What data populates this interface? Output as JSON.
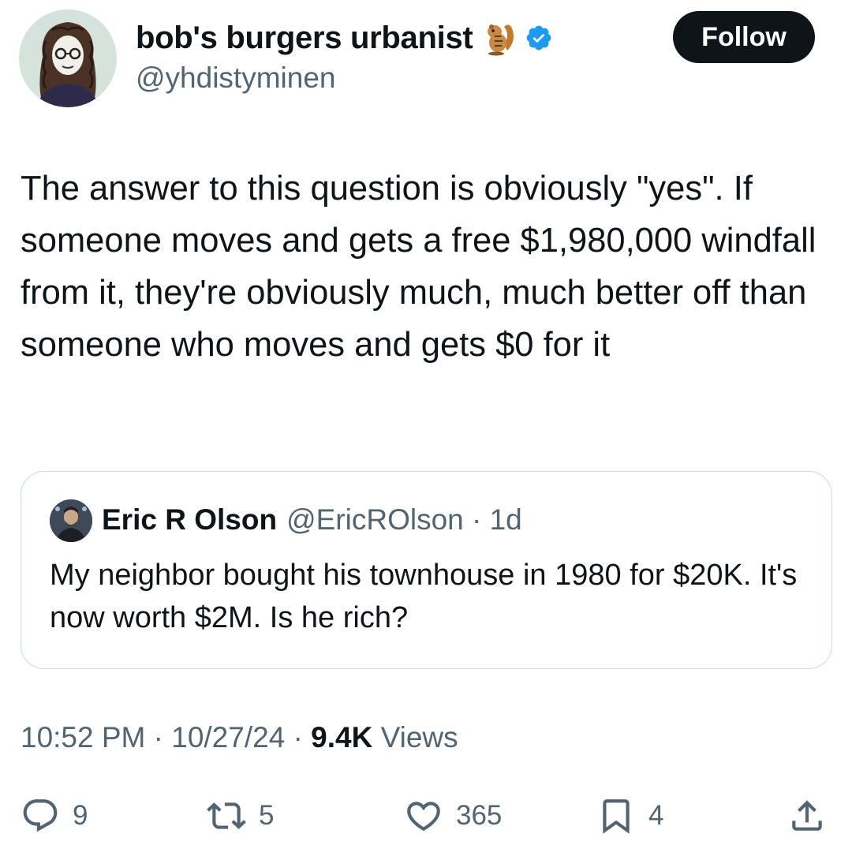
{
  "author": {
    "display_name": "bob's burgers urbanist",
    "handle": "@yhdistyminen",
    "emoji_icon": "chipmunk-icon",
    "verified": true
  },
  "follow_button": {
    "label": "Follow"
  },
  "tweet": {
    "text": "The answer to this question is obviously \"yes\". If someone moves and gets a free $1,980,000 windfall from it, they're obviously much, much better off than someone who moves and gets $0 for it"
  },
  "quote": {
    "name": "Eric R Olson",
    "meta": "@EricROlson · 1d",
    "text": "My neighbor bought his townhouse in 1980 for $20K. It's now worth $2M. Is he rich?"
  },
  "timestamp": {
    "time_date": "10:52 PM · 10/27/24 · ",
    "views_count": "9.4K",
    "views_label": " Views"
  },
  "actions": {
    "replies": "9",
    "reposts": "5",
    "likes": "365",
    "bookmarks": "4"
  },
  "colors": {
    "text": "#0f1419",
    "secondary": "#536471",
    "verified": "#1d9bf0",
    "border": "#cfd9de"
  }
}
